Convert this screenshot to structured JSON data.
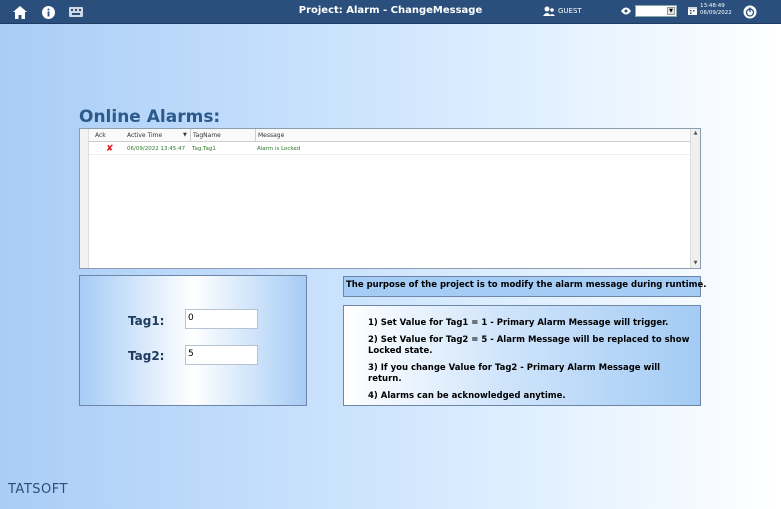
{
  "topbar": {
    "title": "Project: Alarm - ChangeMessage",
    "user": "GUEST",
    "time": "13:48:49",
    "date": "06/09/2022",
    "icons": [
      "home-icon",
      "info-icon",
      "keyboard-icon",
      "user-icon",
      "language-icon",
      "calendar-icon",
      "power-icon"
    ]
  },
  "section_title": "Online Alarms:",
  "alarm_table": {
    "columns": [
      "Ack",
      "Active Time",
      "TagName",
      "Message"
    ],
    "rows": [
      {
        "ack": "✘",
        "active_time": "06/09/2022 13:45:47",
        "tag_name": "Tag.Tag1",
        "message": "Alarm is Locked"
      }
    ]
  },
  "tags": {
    "tag1_label": "Tag1:",
    "tag1_value": "0",
    "tag2_label": "Tag2:",
    "tag2_value": "5"
  },
  "purpose": "The purpose of the project is to modify the alarm message during runtime.",
  "steps": [
    "1) Set Value for Tag1 = 1 - Primary Alarm Message will trigger.",
    "2) Set Value for Tag2 = 5 - Alarm Message will be replaced to show Locked state.",
    "3) If you change Value for Tag2 - Primary Alarm Message will return.",
    "4) Alarms can be acknowledged anytime."
  ],
  "logo": "TATSOFT",
  "colors": {
    "topbar": "#2b4f7c",
    "title": "#2c5a8a",
    "ack": "#d9161d",
    "row_text": "#2b7a2b"
  }
}
